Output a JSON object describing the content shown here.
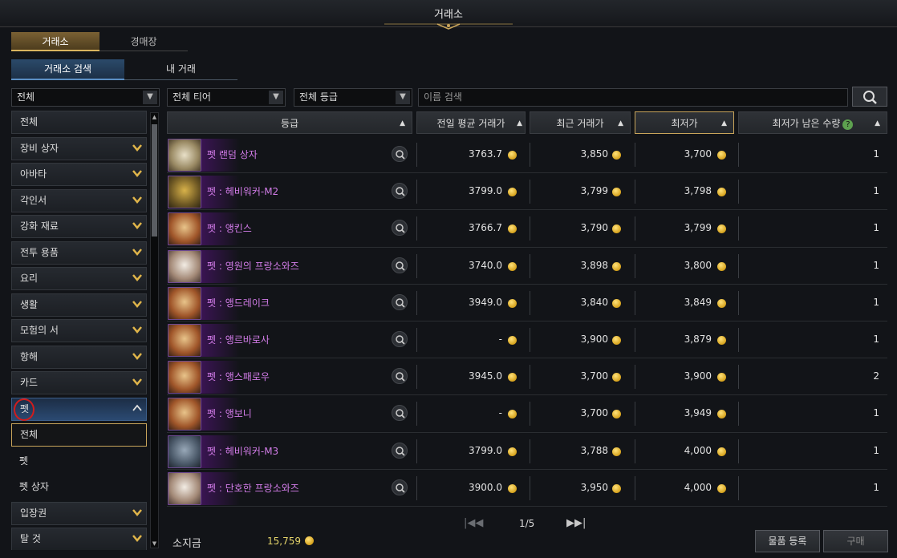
{
  "window": {
    "title": "거래소"
  },
  "tabs_primary": [
    {
      "label": "거래소",
      "active": true
    },
    {
      "label": "경매장",
      "active": false
    }
  ],
  "tabs_secondary": [
    {
      "label": "거래소 검색",
      "active": true
    },
    {
      "label": "내 거래",
      "active": false
    }
  ],
  "filters": {
    "category": "전체",
    "tier": "전체 티어",
    "grade": "전체 등급",
    "search_placeholder": "이름 검색"
  },
  "sidebar": {
    "categories": [
      {
        "label": "전체",
        "chevron": false
      },
      {
        "label": "장비 상자",
        "chevron": true
      },
      {
        "label": "아바타",
        "chevron": true
      },
      {
        "label": "각인서",
        "chevron": true
      },
      {
        "label": "강화 재료",
        "chevron": true
      },
      {
        "label": "전투 용품",
        "chevron": true
      },
      {
        "label": "요리",
        "chevron": true
      },
      {
        "label": "생활",
        "chevron": true
      },
      {
        "label": "모험의 서",
        "chevron": true
      },
      {
        "label": "항해",
        "chevron": true
      },
      {
        "label": "카드",
        "chevron": true
      }
    ],
    "expanded": {
      "label": "펫"
    },
    "subitems": [
      {
        "label": "전체",
        "selected": true
      },
      {
        "label": "펫"
      },
      {
        "label": "펫 상자"
      }
    ],
    "after": [
      {
        "label": "입장권"
      },
      {
        "label": "탈 것"
      }
    ]
  },
  "table": {
    "headers": {
      "grade": "등급",
      "avg_price": "전일 평균 거래가",
      "recent_price": "최근 거래가",
      "lowest_price": "최저가",
      "remaining": "최저가 남은 수량"
    },
    "rows": [
      {
        "name": "펫 랜덤 상자",
        "icon": "box",
        "avg": "3763.7",
        "recent": "3,850",
        "lowest": "3,700",
        "qty": "1"
      },
      {
        "name": "펫 : 헤비워커-M2",
        "icon": "mech",
        "avg": "3799.0",
        "recent": "3,799",
        "lowest": "3,798",
        "qty": "1"
      },
      {
        "name": "펫 : 앵킨스",
        "icon": "owl",
        "avg": "3766.7",
        "recent": "3,790",
        "lowest": "3,799",
        "qty": "1"
      },
      {
        "name": "펫 : 영원의 프랑소와즈",
        "icon": "rabbit",
        "avg": "3740.0",
        "recent": "3,898",
        "lowest": "3,800",
        "qty": "1"
      },
      {
        "name": "펫 : 앵드레이크",
        "icon": "owl",
        "avg": "3949.0",
        "recent": "3,840",
        "lowest": "3,849",
        "qty": "1"
      },
      {
        "name": "펫 : 앵르바로사",
        "icon": "owl",
        "avg": "-",
        "recent": "3,900",
        "lowest": "3,879",
        "qty": "1"
      },
      {
        "name": "펫 : 앵스패로우",
        "icon": "owl",
        "avg": "3945.0",
        "recent": "3,700",
        "lowest": "3,900",
        "qty": "2"
      },
      {
        "name": "펫 : 앵보니",
        "icon": "owl",
        "avg": "-",
        "recent": "3,700",
        "lowest": "3,949",
        "qty": "1"
      },
      {
        "name": "펫 : 헤비워커-M3",
        "icon": "mech2",
        "avg": "3799.0",
        "recent": "3,788",
        "lowest": "4,000",
        "qty": "1"
      },
      {
        "name": "펫 : 단호한 프랑소와즈",
        "icon": "rabbit",
        "avg": "3900.0",
        "recent": "3,950",
        "lowest": "4,000",
        "qty": "1"
      }
    ]
  },
  "pager": {
    "text": "1/5"
  },
  "footer": {
    "money_label": "소지금",
    "money_value": "15,759",
    "register_button": "물품 등록",
    "buy_button": "구매"
  },
  "colors": {
    "accent_gold": "#c8a45a",
    "item_name": "#d27ce8",
    "annotation_circle": "#d21c1c"
  }
}
